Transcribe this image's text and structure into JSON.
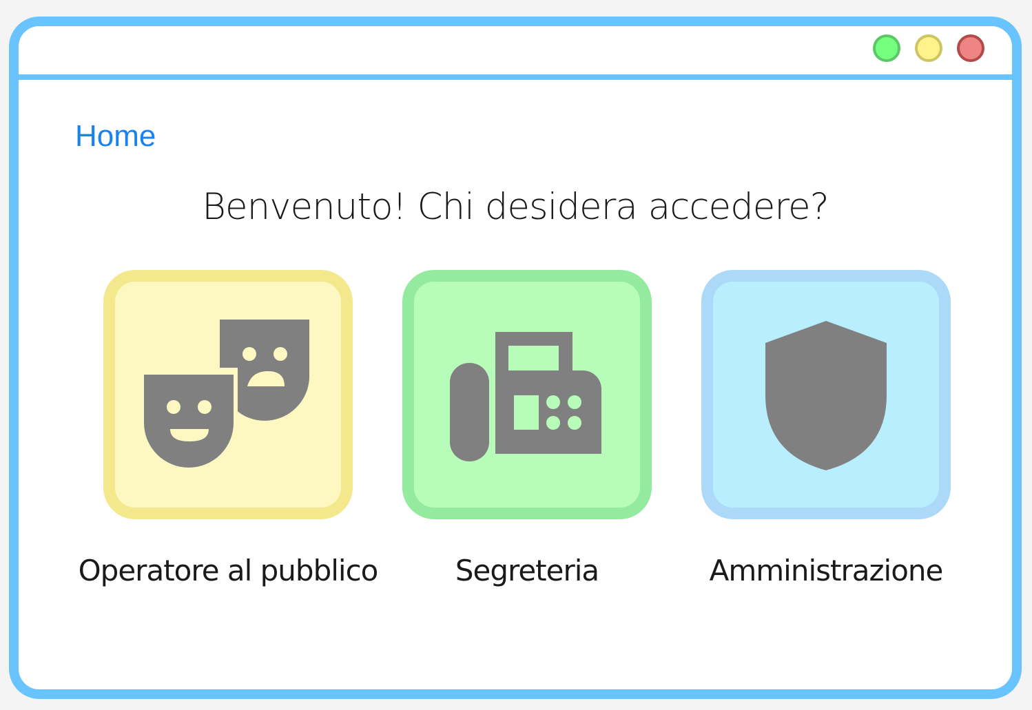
{
  "window": {
    "controls": [
      {
        "name": "maximize",
        "color": "#75fe7f"
      },
      {
        "name": "minimize",
        "color": "#fff28a"
      },
      {
        "name": "close",
        "color": "#ee8484"
      }
    ]
  },
  "breadcrumb": {
    "home_label": "Home"
  },
  "main": {
    "title": "Benvenuto! Chi desidera accedere?",
    "options": [
      {
        "label": "Operatore al pubblico",
        "icon": "theater-masks-icon",
        "color": "#fdf8c1",
        "border": "#f3e88c"
      },
      {
        "label": "Segreteria",
        "icon": "fax-icon",
        "color": "#b7fdb9",
        "border": "#94ea9f"
      },
      {
        "label": "Amministrazione",
        "icon": "shield-icon",
        "color": "#b8eefe",
        "border": "#acd9f8"
      }
    ]
  },
  "colors": {
    "accent": "#69c3ff",
    "link": "#1a82ef",
    "icon": "#808080"
  }
}
